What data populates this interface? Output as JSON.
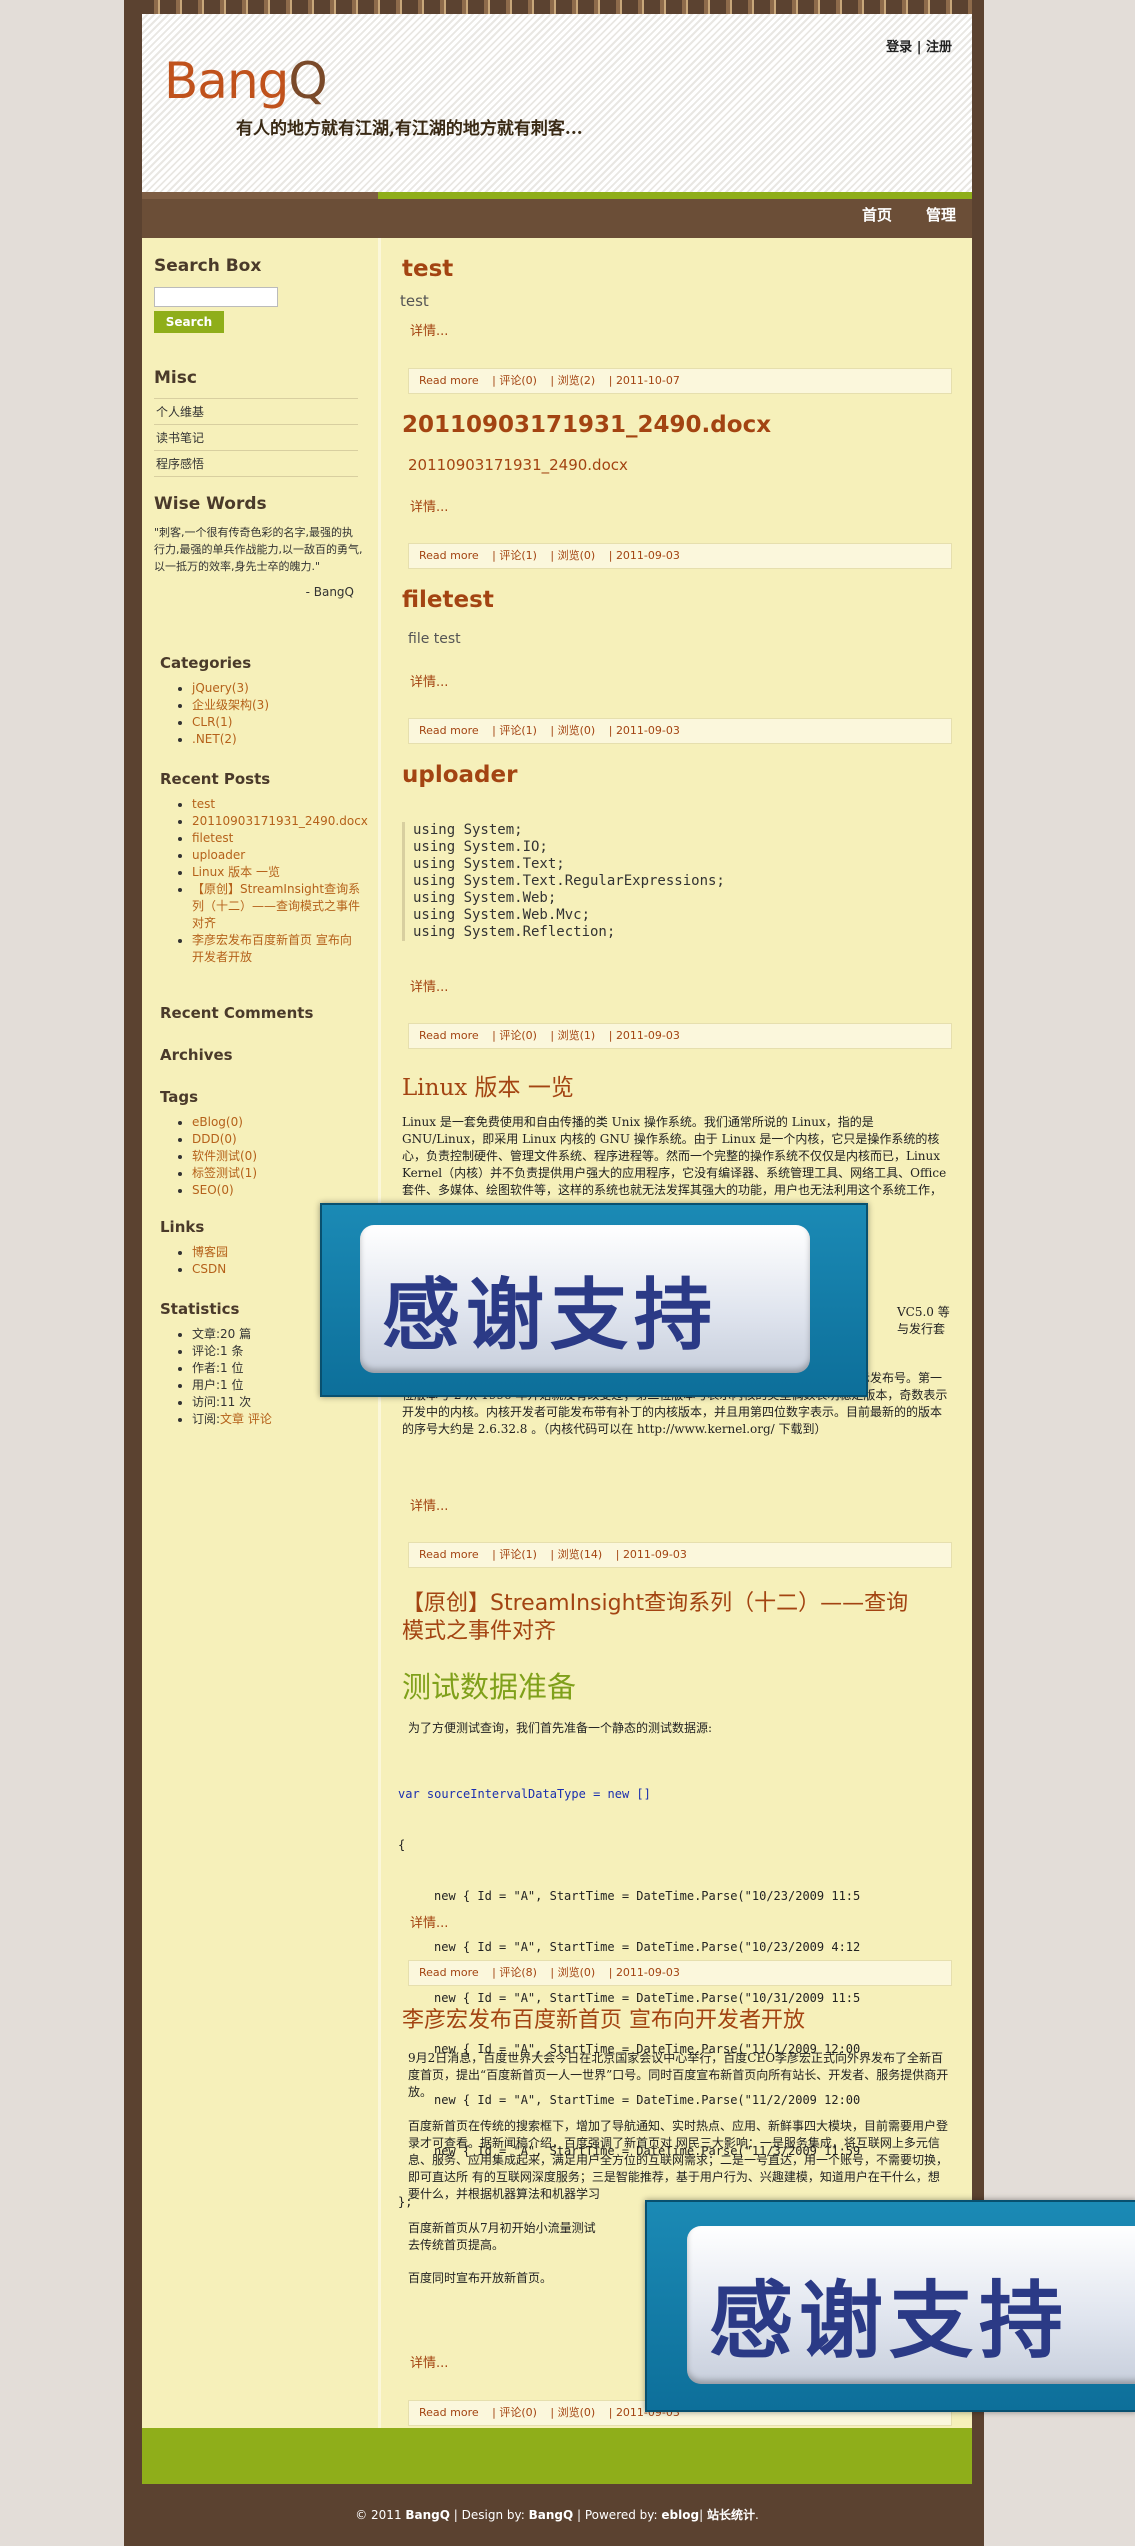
{
  "site": {
    "logo_b": "Bang",
    "logo_q": "Q",
    "tagline": "有人的地方就有江湖,有江湖的地方就有刺客..."
  },
  "toplinks": {
    "login": "登录",
    "sep": " | ",
    "register": "注册"
  },
  "nav": {
    "home": "首页",
    "manage": "管理"
  },
  "sidebar": {
    "search": {
      "title": "Search Box",
      "placeholder": "",
      "button": "Search"
    },
    "misc": {
      "title": "Misc",
      "items": [
        "个人维基",
        "读书笔记",
        "程序感悟"
      ]
    },
    "wise": {
      "title": "Wise Words",
      "quote": "\"刺客,一个很有传奇色彩的名字,最强的执行力,最强的单兵作战能力,以一敌百的勇气,以一抵万的效率,身先士卒的魄力.\"",
      "author": "- BangQ"
    },
    "categories": {
      "title": "Categories",
      "items": [
        "jQuery(3)",
        "企业级架构(3)",
        "CLR(1)",
        ".NET(2)"
      ]
    },
    "recent_posts": {
      "title": "Recent Posts",
      "items": [
        "test",
        "20110903171931_2490.docx",
        "filetest",
        "uploader",
        "Linux 版本 一览",
        "【原创】StreamInsight查询系列（十二）——查询模式之事件对齐",
        "李彦宏发布百度新首页 宣布向开发者开放"
      ]
    },
    "recent_comments": {
      "title": "Recent Comments"
    },
    "archives": {
      "title": "Archives"
    },
    "tags": {
      "title": "Tags",
      "items": [
        "eBlog(0)",
        "DDD(0)",
        "软件测试(0)",
        "标签测试(1)",
        "SEO(0)"
      ]
    },
    "links": {
      "title": "Links",
      "items": [
        "博客园",
        "CSDN"
      ]
    },
    "statistics": {
      "title": "Statistics",
      "items": [
        "文章:20 篇",
        "评论:1 条",
        "作者:1 位",
        "用户:1 位",
        "访问:11 次"
      ],
      "subscribe_label": "订阅:",
      "subscribe_article": "文章",
      "subscribe_comment": "评论"
    }
  },
  "posts": [
    {
      "title": "test",
      "body": "test",
      "more": "详情...",
      "meta": {
        "readmore": "Read more",
        "comments": "评论(0)",
        "views": "浏览(2)",
        "date": "2011-10-07"
      }
    },
    {
      "title": "20110903171931_2490.docx",
      "body": "20110903171931_2490.docx",
      "more": "详情...",
      "meta": {
        "readmore": "Read more",
        "comments": "评论(1)",
        "views": "浏览(0)",
        "date": "2011-09-03"
      }
    },
    {
      "title": "filetest",
      "body": "file test",
      "more": "详情...",
      "meta": {
        "readmore": "Read more",
        "comments": "评论(1)",
        "views": "浏览(0)",
        "date": "2011-09-03"
      }
    },
    {
      "title": "uploader",
      "code": [
        "using System;",
        "using System.IO;",
        "using System.Text;",
        "using System.Text.RegularExpressions;",
        "using System.Web;",
        "using System.Web.Mvc;",
        "using System.Reflection;"
      ],
      "more": "详情...",
      "meta": {
        "readmore": "Read more",
        "comments": "评论(0)",
        "views": "浏览(1)",
        "date": "2011-09-03"
      }
    },
    {
      "title": "Linux 版本  一览",
      "body_top": "Linux 是一套免费使用和自由传播的类 Unix 操作系统。我们通常所说的 Linux，指的是 GNU/Linux，即采用 Linux 内核的 GNU 操作系统。由于 Linux 是一个内核，它只是操作系统的核心，负责控制硬件、管理文件系统、程序进程等。然而一个完整的操作系统不仅仅是内核而已，Linux Kernel（内核）并不负责提供用户强大的应用程序，它没有编译器、系统管理工具、网络工具、Office 套件、多媒体、绘图软件等，这样的系统也就无法发挥其强大的功能，用户也无法利用这个系统工作，因此有人便提出以 Linux Kernel 为核心再集成搭配各式各样的系统程序或应用工具程序组成一套完整的操作系统，经过如此组合的 Linux 套件即称为 Linux 发行版。",
      "body_bottom": "每个内核版本号有三个数字描述，有圆点分割，前两个数字表示版本号，第三个数字表示发布号。第一位版本号 2 从 1996 年开始就没有改变过；第二位版本号表示内核的类型偶数表明稳定版本，奇数表示开发中的内核。内核开发者可能发布带有补丁的内核版本，并且用第四位数字表示。目前最新的的版本的序号大约是 2.6.32.8 。（内核代码可以在 http://www.kernel.org/ 下载到）",
      "right_fragments": [
        "VC5.0 等",
        "与发行套"
      ],
      "more": "详情...",
      "meta": {
        "readmore": "Read more",
        "comments": "评论(1)",
        "views": "浏览(14)",
        "date": "2011-09-03"
      }
    },
    {
      "title_a": "【原创】StreamInsight查询系列（十二）——查询",
      "title_b": "模式之事件对齐",
      "section": "测试数据准备",
      "intro": "为了方便测试查询，我们首先准备一个静态的测试数据源:",
      "code_head": "var sourceIntervalDataType = new []",
      "code_open": "{",
      "code_rows": [
        "new { Id = \"A\", StartTime = DateTime.Parse(\"10/23/2009 11:5",
        "new { Id = \"A\", StartTime = DateTime.Parse(\"10/23/2009 4:12",
        "new { Id = \"A\", StartTime = DateTime.Parse(\"10/31/2009 11:5",
        "new { Id = \"A\", StartTime = DateTime.Parse(\"11/1/2009 12:00",
        "new { Id = \"A\", StartTime = DateTime.Parse(\"11/2/2009 12:00",
        "new { Id = \"A\", StartTime = DateTime.Parse(\"11/3/2009 11:59"
      ],
      "code_close": "};",
      "more": "详情...",
      "meta": {
        "readmore": "Read more",
        "comments": "评论(8)",
        "views": "浏览(0)",
        "date": "2011-09-03"
      }
    },
    {
      "title": "李彦宏发布百度新首页  宣布向开发者开放",
      "p1": "9月2日消息，百度世界大会今日在北京国家会议中心举行，百度CEO李彦宏正式向外界发布了全新百度首页，提出“百度新首页一人一世界”口号。同时百度宣布新首页向所有站长、开发者、服务提供商开放。",
      "p2": "百度新首页在传统的搜索框下，增加了导航通知、实时热点、应用、新鲜事四大模块，目前需要用户登录才可查看。据新闻稿介绍，百度强调了新首页对 网民三大影响：一是服务集成，将互联网上多元信息、服务、应用集成起来，满足用户全方位的互联网需求；二是一号直达，用一个账号，不需要切换，即可直达所 有的互联网深度服务；三是智能推荐，基于用户行为、兴趣建模，知道用户在干什么，想要什么，并根据机器算法和机器学习",
      "p3": "百度新首页从7月初开始小流量测试",
      "p3b": "去传统首页提高。",
      "p4": "百度同时宣布开放新首页。",
      "more": "详情...",
      "meta": {
        "readmore": "Read more",
        "comments": "评论(0)",
        "views": "浏览(0)",
        "date": "2011-09-03"
      }
    }
  ],
  "banner": {
    "text": "感谢支持"
  },
  "footer": {
    "copy": "© 2011 ",
    "brand1": "BangQ",
    "design_by": " | Design by: ",
    "brand2": "BangQ",
    "powered": " | Powered by: ",
    "eblog": "eblog",
    "sep": "| ",
    "stats": "站长统计",
    "end": "."
  }
}
